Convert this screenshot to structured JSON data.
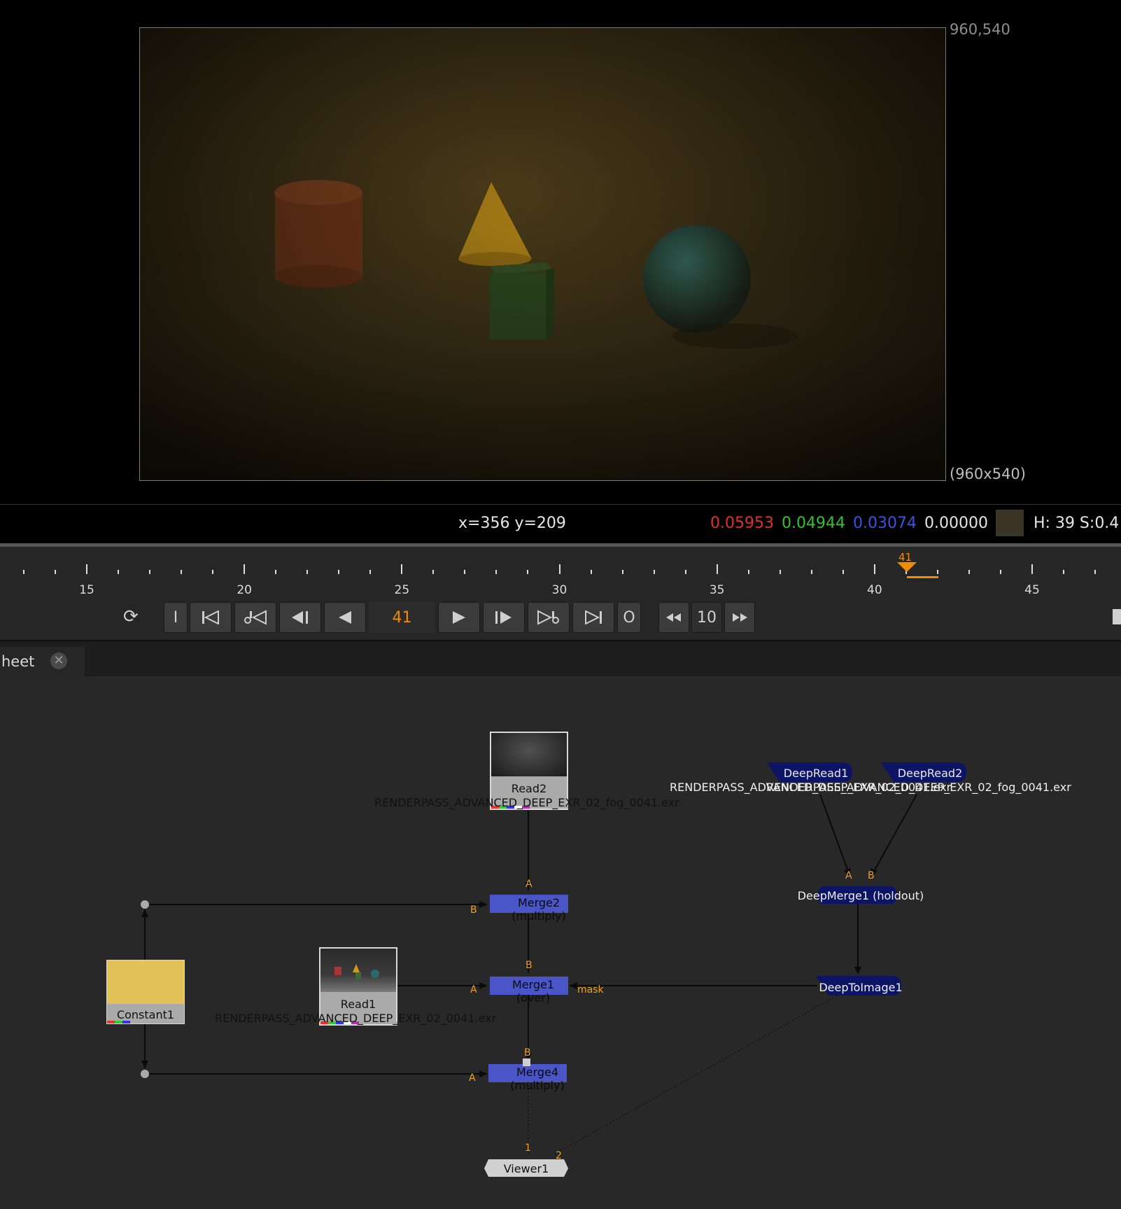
{
  "viewer": {
    "top_right_label": "960,540",
    "bottom_right_label": "(960x540)",
    "coords": "x=356 y=209",
    "pixel": {
      "r": "0.05953",
      "g": "0.04944",
      "b": "0.03074",
      "a": "0.00000",
      "swatch_color": "#3b3324"
    },
    "hsv": "H: 39 S:0.4"
  },
  "timeline": {
    "current_frame": "41",
    "labels": [
      "15",
      "20",
      "25",
      "30",
      "35",
      "40",
      "45"
    ],
    "accent": "#f08c00"
  },
  "transport": {
    "frame_field": "41",
    "in_label": "I",
    "out_label": "O",
    "step_value": "10"
  },
  "tabs": {
    "label": "heet"
  },
  "nodes": {
    "read2": {
      "label": "Read2",
      "path": "RENDERPASS_ADVANCED_DEEP_EXR_02_fog_0041.exr"
    },
    "read1": {
      "label": "Read1",
      "path": "RENDERPASS_ADVANCED_DEEP_EXR_02_0041.exr"
    },
    "constant1": {
      "label": "Constant1",
      "color": "#e3c25a"
    },
    "merge2": {
      "label": "Merge2 (multiply)"
    },
    "merge1": {
      "label": "Merge1 (over)",
      "mask_label": "mask"
    },
    "merge4": {
      "label": "Merge4 (multiply)"
    },
    "viewer1": {
      "label": "Viewer1"
    },
    "deepread1": {
      "label": "DeepRead1",
      "path": "RENDERPASS_ADVANCED_DEEP_EXR_02_0041.exr"
    },
    "deepread2": {
      "label": "DeepRead2",
      "path": "RENDERPASS_ADVANCED_DEEP_EXR_02_fog_0041.exr"
    },
    "deepmerge1": {
      "label": "DeepMerge1 (holdout)"
    },
    "deeptoimage1": {
      "label": "DeepToImage1"
    }
  },
  "inputs": {
    "a": "A",
    "b": "B",
    "one": "1",
    "two": "2"
  }
}
